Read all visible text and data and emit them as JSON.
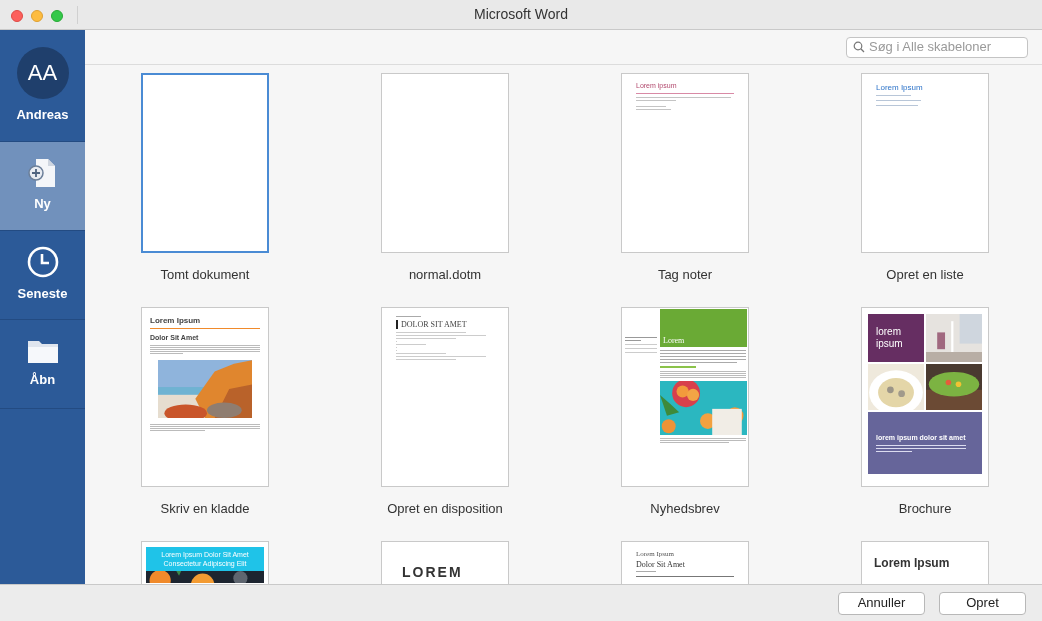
{
  "window": {
    "title": "Microsoft Word"
  },
  "sidebar": {
    "items": [
      {
        "kind": "account",
        "label": "Andreas",
        "initials": "AA",
        "selected": false
      },
      {
        "kind": "new",
        "label": "Ny",
        "selected": true
      },
      {
        "kind": "recent",
        "label": "Seneste",
        "selected": false
      },
      {
        "kind": "open",
        "label": "Åbn",
        "selected": false
      }
    ]
  },
  "search": {
    "placeholder": "Søg i Alle skabeloner"
  },
  "templates": [
    {
      "kind": "blank",
      "label": "Tomt dokument",
      "selected": true
    },
    {
      "kind": "blank",
      "label": "normal.dotm",
      "selected": false
    },
    {
      "kind": "notes",
      "label": "Tag noter",
      "selected": false,
      "texts": [
        "Lorem ipsum"
      ]
    },
    {
      "kind": "list",
      "label": "Opret en liste",
      "selected": false,
      "texts": [
        "Lorem Ipsum"
      ]
    },
    {
      "kind": "draft",
      "label": "Skriv en kladde",
      "selected": false,
      "texts": [
        "Lorem Ipsum",
        "Dolor Sit Amet"
      ]
    },
    {
      "kind": "outline",
      "label": "Opret en disposition",
      "selected": false,
      "texts": [
        "DOLOR SIT AMET"
      ]
    },
    {
      "kind": "newsletter",
      "label": "Nyhedsbrev",
      "selected": false,
      "texts": [
        "Lorem"
      ]
    },
    {
      "kind": "brochure",
      "label": "Brochure",
      "selected": false,
      "texts": [
        "lorem ipsum",
        "lorem ipsum dolor sit amet"
      ]
    },
    {
      "kind": "cover",
      "selected": false,
      "texts": [
        "Lorem Ipsum Dolor Sit Amet",
        "Consectetur Adipiscing Elit"
      ]
    },
    {
      "kind": "big",
      "selected": false,
      "texts": [
        "LOREM"
      ]
    },
    {
      "kind": "serif",
      "selected": false,
      "texts": [
        "Lorem Ipsum",
        "Dolor Sit Amet"
      ]
    },
    {
      "kind": "title",
      "selected": false,
      "texts": [
        "Lorem Ipsum"
      ]
    }
  ],
  "buttons": [
    {
      "label": "Annuller"
    },
    {
      "label": "Opret"
    }
  ]
}
